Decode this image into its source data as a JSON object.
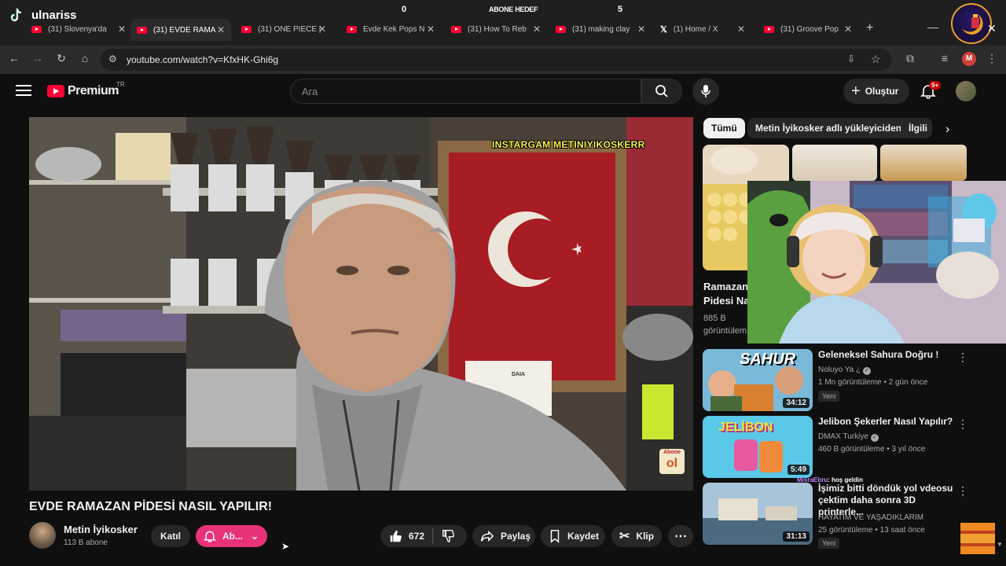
{
  "overlay": {
    "tiktok_user": "ulnariss",
    "goal_left": "0",
    "goal_label": "ABONE HEDEF",
    "goal_right": "5"
  },
  "tabs": [
    {
      "label": "(31) Slovenya'da"
    },
    {
      "label": "(31) EVDE RAMA"
    },
    {
      "label": "(31) ONE PIECE |"
    },
    {
      "label": "Evde Kek Pops N"
    },
    {
      "label": "(31) How To Reb"
    },
    {
      "label": "(31) making clay"
    },
    {
      "label": "(1) Home / X"
    },
    {
      "label": "(31) Groove Pop"
    }
  ],
  "browser": {
    "url": "youtube.com/watch?v=KfxHK-Ghi6g",
    "profile_letter": "M"
  },
  "yt": {
    "brand": "Premium",
    "region": "TR",
    "search_placeholder": "Ara",
    "create_label": "Oluştur",
    "notif_count": "9+"
  },
  "video": {
    "caption": "INSTARGAM METINIYIKOSKERR",
    "store_sign": "DAIA",
    "sticker_top": "Abone",
    "sticker_bottom": "ol",
    "title": "EVDE RAMAZAN PİDESİ NASIL YAPILIR!"
  },
  "channel": {
    "name": "Metin İyikosker",
    "subs": "113 B abone",
    "join_label": "Katıl",
    "subscribe_label": "Ab..."
  },
  "actions": {
    "likes": "672",
    "share": "Paylaş",
    "save": "Kaydet",
    "clip": "Klip"
  },
  "chips": [
    "Tümü",
    "Metin İyikosker adlı yükleyiciden",
    "İlgili"
  ],
  "partial_rec": {
    "title_line1": "Ramazan",
    "title_line2": "Pidesi Na",
    "views": "885 B",
    "meta": "görüntülem"
  },
  "recommendations": [
    {
      "title": "Geleneksel Sahura Doğru !",
      "channel": "Noluyo Ya ¿",
      "meta": "1 Mn görüntüleme • 2 gün önce",
      "badge": "Yeni",
      "duration": "34:12",
      "thumb_text": "SAHUR"
    },
    {
      "title": "Jelibon Şekerler Nasıl Yapılır?",
      "channel": "DMAX Turkiye",
      "meta": "460 B görüntüleme • 3 yıl önce",
      "badge": "",
      "duration": "5:49",
      "thumb_text": "JELİBON"
    },
    {
      "title": "İşimiz bitti döndük yol vdeosu çektim daha sonra 3D printerle...",
      "channel": "HAYATIM VE YAŞADIKLARIM",
      "meta": "25 görüntüleme • 13 saat önce",
      "badge": "Yeni",
      "duration": "31:13",
      "thumb_text": ""
    }
  ],
  "chat": {
    "line1_user": "MisraEbru",
    "line1_msg": "hoş geldin"
  }
}
